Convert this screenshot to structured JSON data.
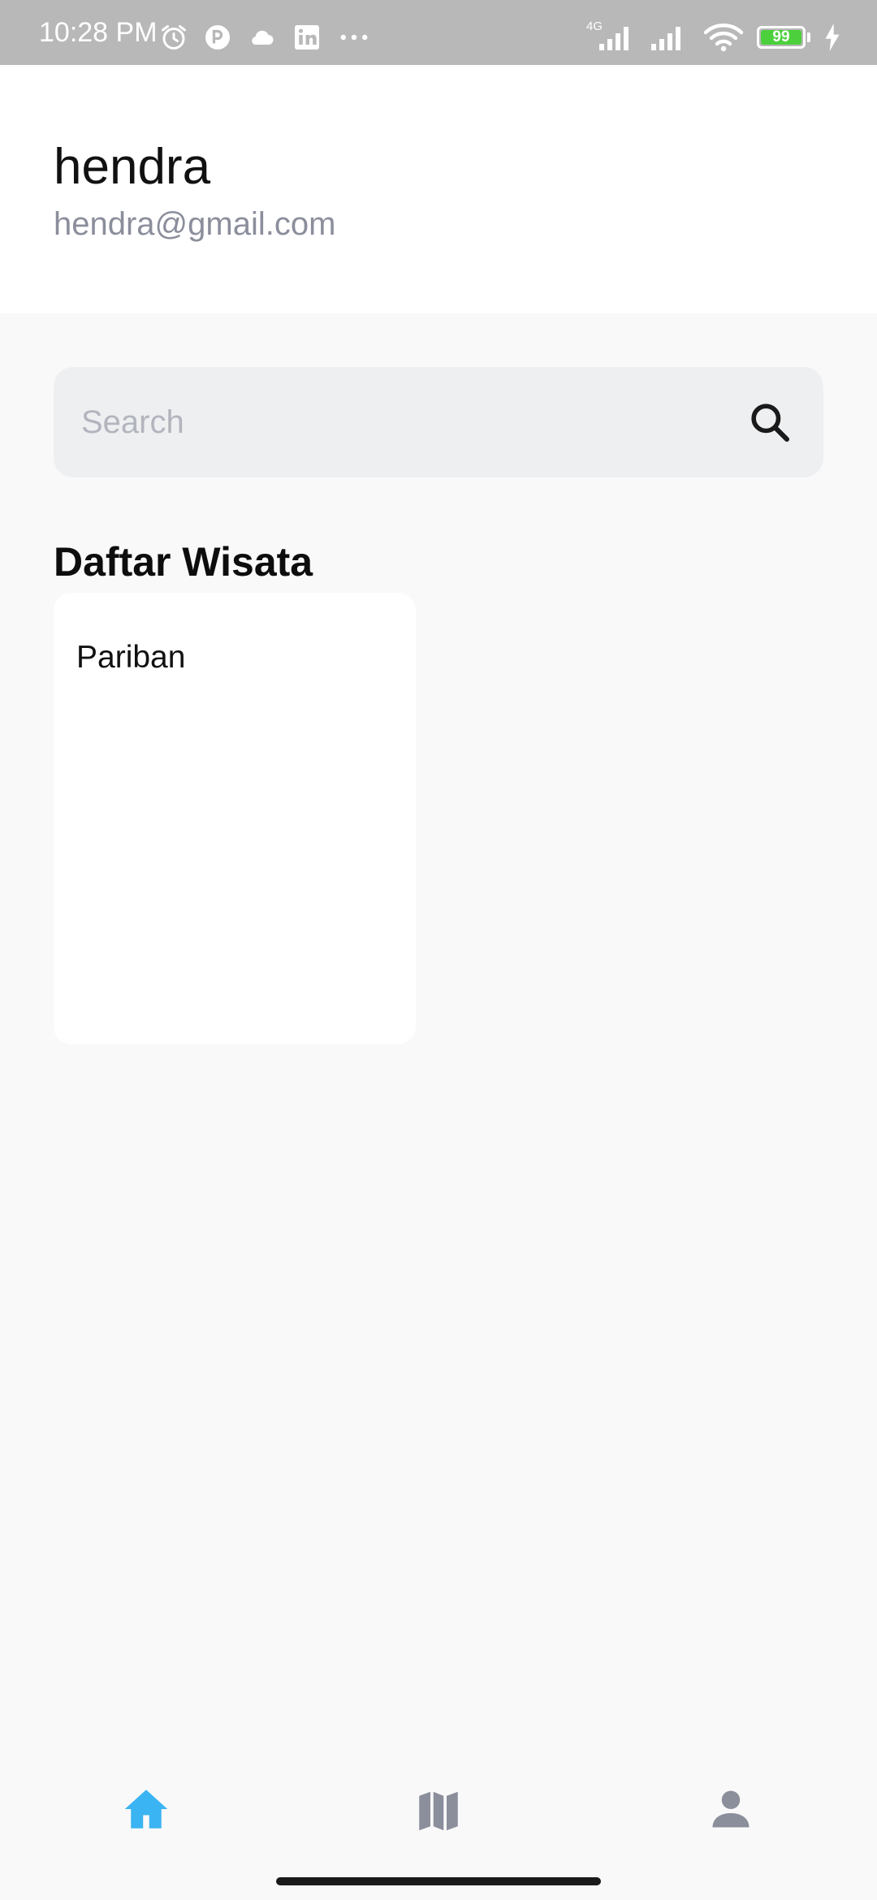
{
  "status_bar": {
    "time": "10:28 PM",
    "network_label": "4G",
    "battery_level": "99",
    "battery_fraction": 0.99,
    "icons_left": [
      "alarm-icon",
      "app-badge-icon",
      "cloud-icon",
      "linkedin-icon",
      "more-dots-icon"
    ],
    "icons_right": [
      "signal-4g-icon",
      "signal-icon",
      "wifi-icon",
      "battery-icon",
      "charging-icon"
    ]
  },
  "profile": {
    "name": "hendra",
    "email": "hendra@gmail.com"
  },
  "search": {
    "placeholder": "Search",
    "value": "",
    "icon": "search-icon"
  },
  "section": {
    "title": "Daftar Wisata"
  },
  "destinations": [
    {
      "name": "Pariban"
    }
  ],
  "bottom_nav": {
    "items": [
      {
        "name": "home",
        "icon": "home-icon",
        "active": true
      },
      {
        "name": "map",
        "icon": "map-icon",
        "active": false
      },
      {
        "name": "profile",
        "icon": "person-icon",
        "active": false
      }
    ]
  },
  "colors": {
    "status_bar_bg": "#b8b8b8",
    "header_bg": "#ffffff",
    "page_bg": "#f9f9fa",
    "search_bg": "#eeeff1",
    "nav_active": "#3ab4f2",
    "nav_inactive": "#8b8e9b",
    "email_text": "#8b8e9b",
    "battery_fill": "#4cd03c"
  }
}
